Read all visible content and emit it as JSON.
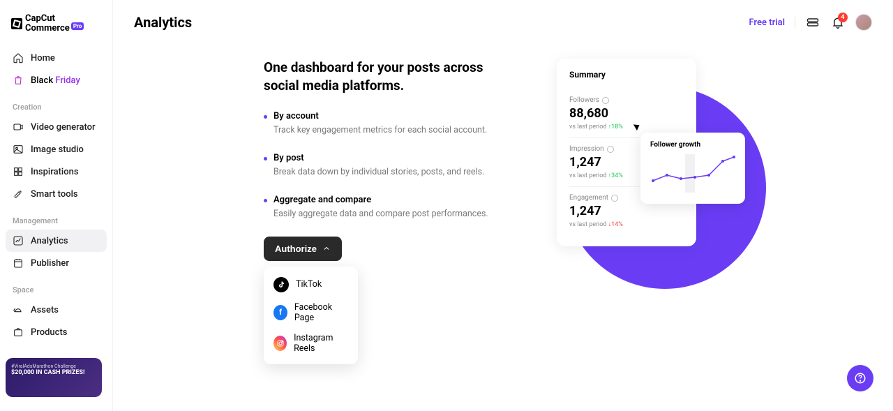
{
  "brand": {
    "name": "CapCut",
    "sub": "Commerce",
    "badge": "Pro"
  },
  "header": {
    "title": "Analytics",
    "free_trial": "Free trial",
    "notif_count": "4"
  },
  "sidebar": {
    "home": "Home",
    "black_friday_prefix": "Black ",
    "black_friday_suffix": "Friday",
    "section_creation": "Creation",
    "video_gen": "Video generator",
    "image_studio": "Image studio",
    "inspirations": "Inspirations",
    "smart_tools": "Smart tools",
    "section_mgmt": "Management",
    "analytics": "Analytics",
    "publisher": "Publisher",
    "section_space": "Space",
    "assets": "Assets",
    "products": "Products"
  },
  "promo": {
    "hashtag": "#ViralAdsMarathon Challenge",
    "prize": "$20,000 IN CASH PRIZES!"
  },
  "hero": {
    "title": "One dashboard for your posts across social media platforms.",
    "points": [
      {
        "title": "By account",
        "desc": "Track key engagement metrics for each social account."
      },
      {
        "title": "By post",
        "desc": "Break data down by individual stories, posts, and reels."
      },
      {
        "title": "Aggregate and compare",
        "desc": "Easily aggregate data and compare post performances."
      }
    ],
    "authorize": "Authorize",
    "options": {
      "tiktok": "TikTok",
      "facebook": "Facebook Page",
      "instagram": "Instagram Reels"
    }
  },
  "summary": {
    "title": "Summary",
    "followers": {
      "label": "Followers",
      "value": "88,680",
      "delta_prefix": "vs last period ",
      "delta": "↑18%"
    },
    "impression": {
      "label": "Impression",
      "value": "1,247",
      "delta_prefix": "vs last period ",
      "delta": "↑34%"
    },
    "engagement": {
      "label": "Engagement",
      "value": "1,247",
      "delta_prefix": "vs last period ",
      "delta": "↓14%"
    }
  },
  "growth": {
    "title": "Follower growth"
  }
}
